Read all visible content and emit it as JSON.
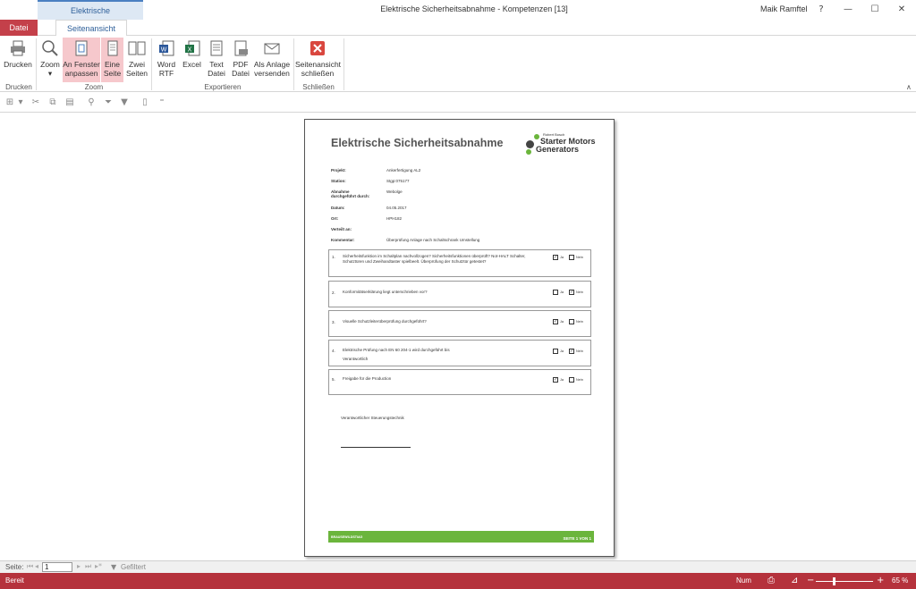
{
  "window": {
    "context_tab": "Elektrische Sicherheitsabnahme",
    "title": "Elektrische Sicherheitsabnahme  -  Kompetenzen [13]",
    "user": "Maik Ramftel",
    "help": "?",
    "minimize": "—",
    "restore": "☐",
    "close": "✕"
  },
  "tabs": {
    "datei": "Datei",
    "seitenansicht": "Seitenansicht"
  },
  "ribbon": {
    "drucken": "Drucken",
    "zoom": "Zoom",
    "an_fenster_1": "An Fenster",
    "an_fenster_2": "anpassen",
    "eine_1": "Eine",
    "eine_2": "Seite",
    "zwei_1": "Zwei",
    "zwei_2": "Seiten",
    "word_1": "Word",
    "word_2": "RTF",
    "excel": "Excel",
    "text_1": "Text",
    "text_2": "Datei",
    "pdf_1": "PDF",
    "pdf_2": "Datei",
    "anlage_1": "Als Anlage",
    "anlage_2": "versenden",
    "schliessen_1": "Seitenansicht",
    "schliessen_2": "schließen",
    "groups": {
      "drucken": "Drucken",
      "zoom": "Zoom",
      "exportieren": "Exportieren",
      "schliessen": "Schließen"
    }
  },
  "report": {
    "title": "Elektrische Sicherheitsabnahme",
    "logo_top": "Robert Bosch",
    "logo_line1": "Starter Motors",
    "logo_line2": "Generators",
    "fields": {
      "projekt_label": "Projekt:",
      "projekt_value": "Ankerfertigung AL2",
      "station_label": "Station:",
      "station_value": "Stgp:075177",
      "abnahme_label_1": "Abnahme",
      "abnahme_label_2": "durchgeführt durch:",
      "abnahme_value": "Webolge",
      "datum_label": "Datum:",
      "datum_value": "04.05.2017",
      "ort_label": "Ort:",
      "ort_value": "HPH182",
      "verteilt_label": "Verteilt an:",
      "kommentar_label": "Kommentar:",
      "kommentar_value": "Überprüfung Anlage nach Schaltschrank Umstellung"
    },
    "questions": [
      {
        "num": "1.",
        "text": "Sicherheitsfunktion im Schaltplan nachvollzogen? Sicherheitsfunktionen überprüft? Not-HALT Schalter, Schutztüren und Zweihandtaster spielbeelt. Überprüfung der Schutztür getestet?",
        "extra": "",
        "ja": true,
        "nein": false
      },
      {
        "num": "2.",
        "text": "Konformitätserklärung liegt unterschrieben vor?",
        "extra": "",
        "ja": false,
        "nein": true
      },
      {
        "num": "3.",
        "text": "Visuelle Schutzleiterüberprüfung durchgeführt?",
        "extra": "",
        "ja": true,
        "nein": false
      },
      {
        "num": "4.",
        "text": "Elektrische Prüfung nach EN 60 204-1 wird durchgeführt bis",
        "extra": "Verantwortlich",
        "ja": false,
        "nein": true
      },
      {
        "num": "5.",
        "text": "Freigabe für die Production",
        "extra": "",
        "ja": true,
        "nein": false
      }
    ],
    "ja_label": "Ja",
    "nein_label": "Nein",
    "signer": "Verantwortlicher Steuerungstechnik",
    "footer_left": "BRAUSEWILDSTIAG",
    "footer_right": "SEITE 1 VON 1"
  },
  "navigation": {
    "label": "Seite:",
    "page_value": "1",
    "filter": "Gefiltert"
  },
  "status": {
    "left": "Bereit",
    "num": "Num",
    "zoom": "65 %",
    "zoom_level_percent": 65
  },
  "colors": {
    "accent_red": "#b5323c",
    "report_green": "#6bb53c",
    "active_button": "#f6c8cc"
  }
}
